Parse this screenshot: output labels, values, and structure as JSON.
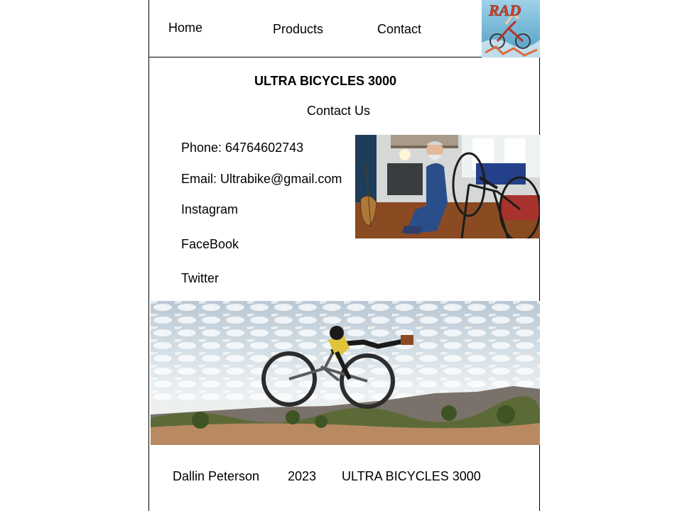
{
  "nav": {
    "home": "Home",
    "products": "Products",
    "contact": "Contact"
  },
  "logo": {
    "text": "RAD"
  },
  "page": {
    "title": "ULTRA BICYCLES 3000",
    "subtitle": "Contact Us"
  },
  "contact": {
    "phone": "Phone: 64764602743",
    "email": "Email: Ultrabike@gmail.com",
    "instagram": "Instagram",
    "facebook": "FaceBook",
    "twitter": "Twitter"
  },
  "images": {
    "repair_photo": "man-repairing-bicycle-photo",
    "jump_photo": "mountain-bike-jump-photo"
  },
  "footer": {
    "author": "Dallin Peterson",
    "year": "2023",
    "brand": "ULTRA BICYCLES 3000"
  },
  "colors": {
    "border": "#000000",
    "background": "#ffffff",
    "logo_red": "#d8452b",
    "logo_sky": "#6fb7d8"
  }
}
